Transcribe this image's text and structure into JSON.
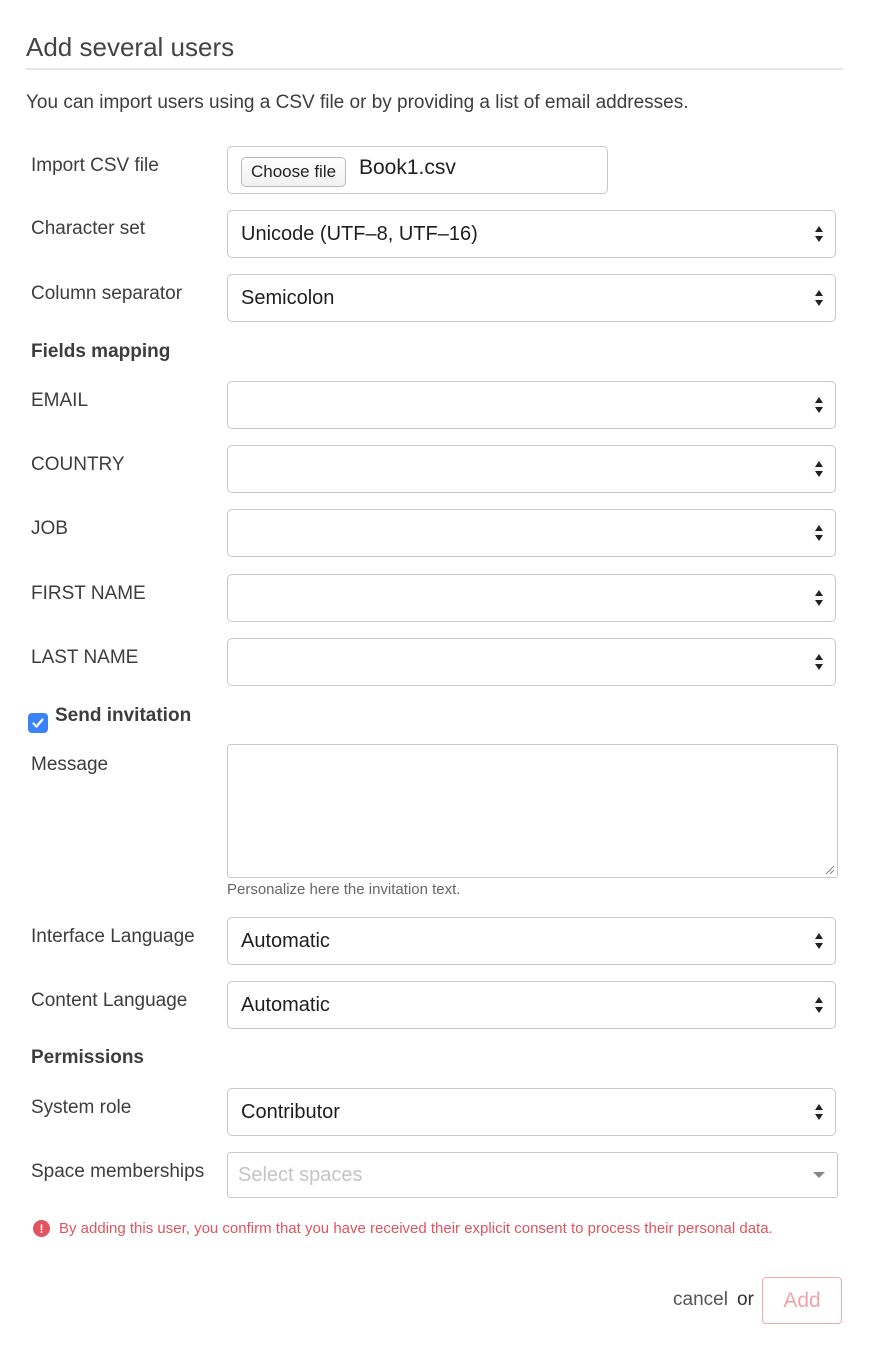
{
  "header": {
    "title": "Add several users",
    "intro": "You can import users using a CSV file or by providing a list of email addresses."
  },
  "import": {
    "label": "Import CSV file",
    "choose_button": "Choose file",
    "file_name": "Book1.csv"
  },
  "charset": {
    "label": "Character set",
    "value": "Unicode (UTF–8, UTF–16)"
  },
  "separator": {
    "label": "Column separator",
    "value": "Semicolon"
  },
  "mapping": {
    "heading": "Fields mapping",
    "fields": [
      {
        "label": "EMAIL",
        "value": ""
      },
      {
        "label": "COUNTRY",
        "value": ""
      },
      {
        "label": "JOB",
        "value": ""
      },
      {
        "label": "FIRST NAME",
        "value": ""
      },
      {
        "label": "LAST NAME",
        "value": ""
      }
    ]
  },
  "invitation": {
    "checkbox_label": "Send invitation",
    "checked": true,
    "message_label": "Message",
    "message_value": "",
    "hint": "Personalize here the invitation text."
  },
  "interface_language": {
    "label": "Interface Language",
    "value": "Automatic"
  },
  "content_language": {
    "label": "Content Language",
    "value": "Automatic"
  },
  "permissions": {
    "heading": "Permissions",
    "system_role_label": "System role",
    "system_role_value": "Contributor",
    "spaces_label": "Space memberships",
    "spaces_placeholder": "Select spaces"
  },
  "consent": {
    "icon": "exclamation-circle-icon",
    "text": "By adding this user, you confirm that you have received their explicit consent to process their personal data."
  },
  "actions": {
    "cancel": "cancel",
    "or": "or",
    "add": "Add"
  },
  "colors": {
    "accent": "#3b82f6",
    "warning": "#e0535f",
    "add_button": "#f0a3aa"
  }
}
